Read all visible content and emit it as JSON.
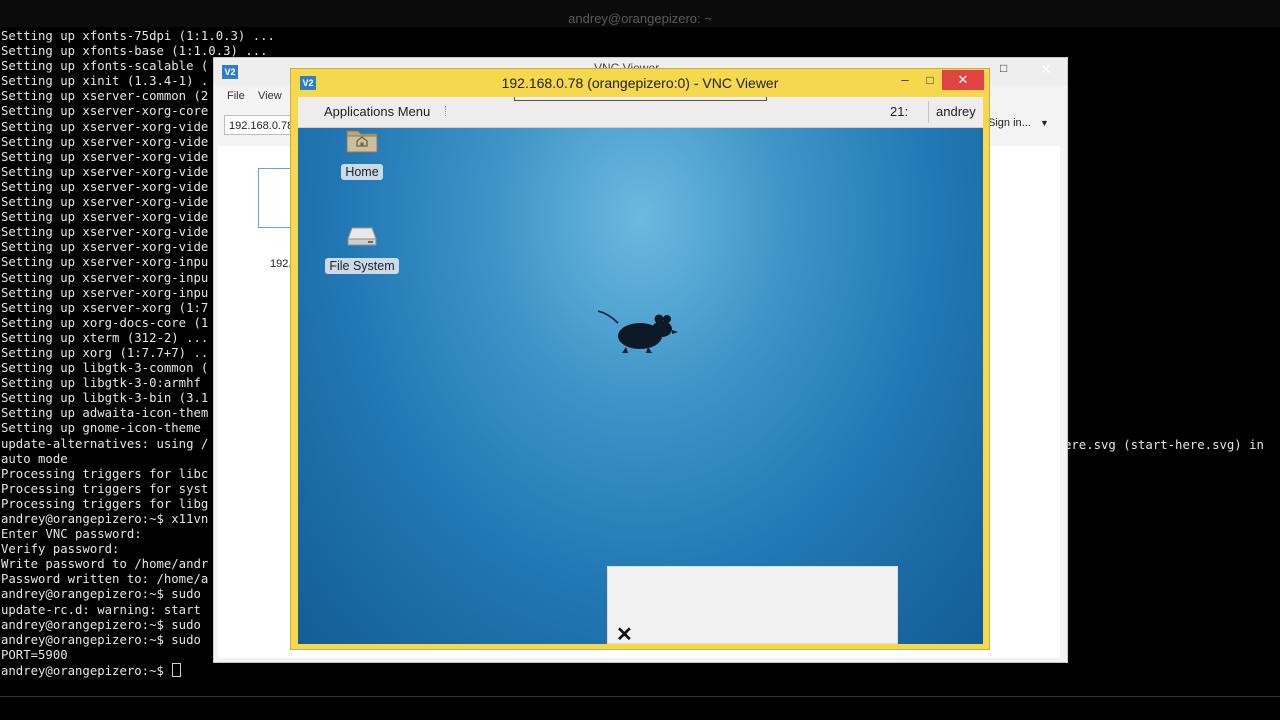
{
  "terminal": {
    "title": "andrey@orangepizero: ~",
    "lines": [
      "Setting up xfonts-75dpi (1:1.0.3) ...",
      "Setting up xfonts-base (1:1.0.3) ...",
      "Setting up xfonts-scalable (",
      "Setting up xinit (1.3.4-1) .",
      "Setting up xserver-common (2",
      "Setting up xserver-xorg-core",
      "Setting up xserver-xorg-vide",
      "Setting up xserver-xorg-vide",
      "Setting up xserver-xorg-vide",
      "Setting up xserver-xorg-vide",
      "Setting up xserver-xorg-vide",
      "Setting up xserver-xorg-vide",
      "Setting up xserver-xorg-vide",
      "Setting up xserver-xorg-vide",
      "Setting up xserver-xorg-vide",
      "Setting up xserver-xorg-inpu",
      "Setting up xserver-xorg-inpu",
      "Setting up xserver-xorg-inpu",
      "Setting up xserver-xorg (1:7",
      "Setting up xorg-docs-core (1",
      "Setting up xterm (312-2) ...",
      "Setting up xorg (1:7.7+7) ..",
      "Setting up libgtk-3-common (",
      "Setting up libgtk-3-0:armhf",
      "Setting up libgtk-3-bin (3.1",
      "Setting up adwaita-icon-them",
      "Setting up gnome-icon-theme",
      "update-alternatives: using /",
      "auto mode",
      "Processing triggers for libc",
      "Processing triggers for syst",
      "Processing triggers for libg",
      "andrey@orangepizero:~$ x11vn",
      "Enter VNC password:",
      "Verify password:",
      "Write password to /home/andr",
      "Password written to: /home/a",
      "andrey@orangepizero:~$ sudo",
      "update-rc.d: warning: start",
      "andrey@orangepizero:~$ sudo",
      "andrey@orangepizero:~$ sudo",
      "PORT=5900",
      "andrey@orangepizero:~$ "
    ],
    "right_fragment": "ere.svg (start-here.svg) in"
  },
  "vnc_main": {
    "title": "VNC Viewer",
    "menu": [
      "File",
      "View"
    ],
    "address_value": "192.168.0.78",
    "signin_label": "Sign in...",
    "thumbnail_label": "192."
  },
  "vnc_session": {
    "logo": "V2",
    "title": "192.168.0.78 (orangepizero:0) - VNC Viewer",
    "min_glyph": "–",
    "max_glyph": "□",
    "close_glyph": "✕"
  },
  "remote": {
    "applications_menu": "Applications Menu",
    "clock": "21:",
    "user": "andrey",
    "icons": [
      {
        "label": "Home",
        "icon": "home-folder-icon"
      },
      {
        "label": "File System",
        "icon": "drive-icon"
      }
    ],
    "notify_close_glyph": "✕"
  },
  "colors": {
    "session_border": "#f5d84d",
    "close_red": "#e04343",
    "desktop_blue": "#2279b5"
  }
}
